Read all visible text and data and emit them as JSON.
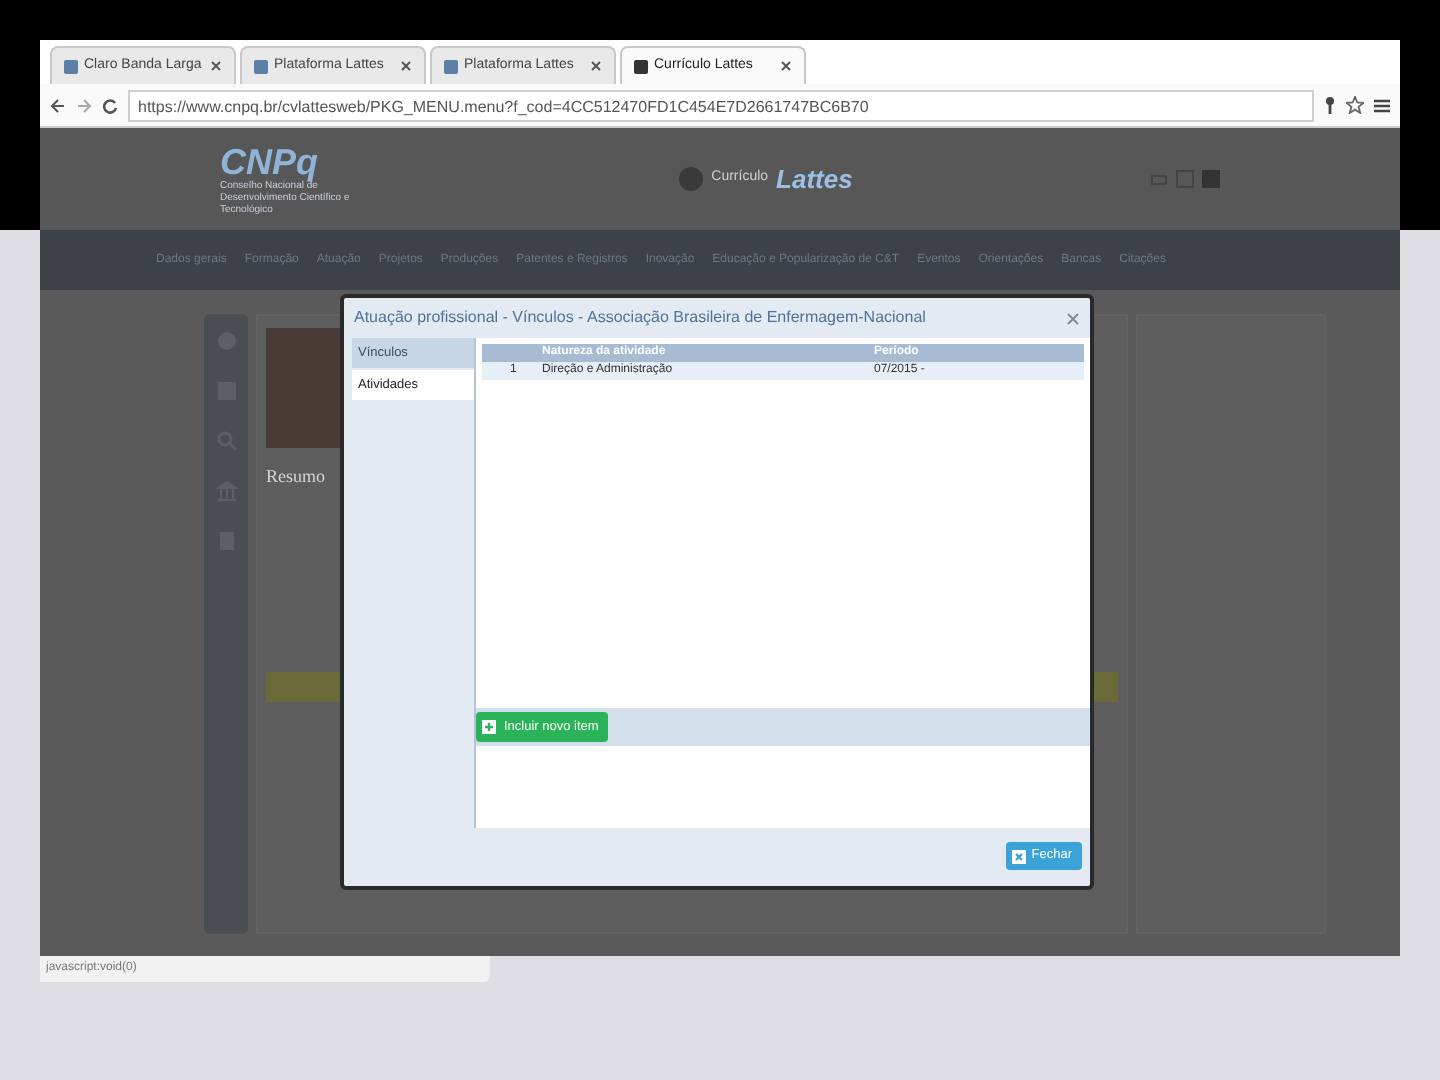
{
  "browser": {
    "tabs": [
      {
        "title": "Claro Banda Larga",
        "selected": false
      },
      {
        "title": "Plataforma Lattes",
        "selected": false
      },
      {
        "title": "Plataforma Lattes",
        "selected": false
      },
      {
        "title": "Currículo Lattes",
        "selected": true
      }
    ],
    "address": "https://www.cnpq.br/cvlattesweb/PKG_MENU.menu?f_cod=4CC512470FD1C454E7D2661747BC6B70"
  },
  "site": {
    "logo": "CNPq",
    "logo_subtitle": "Conselho Nacional de Desenvolvimento Científico e Tecnológico",
    "brand_prefix": "Currículo",
    "brand": "Lattes",
    "nav": [
      "Dados gerais",
      "Formação",
      "Atuação",
      "Projetos",
      "Produções",
      "Patentes e Registros",
      "Inovação",
      "Educação e Popularização de C&T",
      "Eventos",
      "Orientações",
      "Bancas",
      "Citações"
    ],
    "resumo_title": "Resumo"
  },
  "dialog": {
    "title": "Atuação profissional - Vínculos - Associação Brasileira de Enfermagem-Nacional",
    "side_tabs": [
      {
        "label": "Vínculos",
        "selected": false
      },
      {
        "label": "Atividades",
        "selected": true
      }
    ],
    "columns": [
      "Natureza da atividade",
      "Período"
    ],
    "rows": [
      {
        "index": "1",
        "activity": "Direção e Administração",
        "period": "07/2015 -"
      }
    ],
    "add_button": "Incluir novo item",
    "close_button": "Fechar"
  },
  "status_bar": "javascript:void(0)"
}
